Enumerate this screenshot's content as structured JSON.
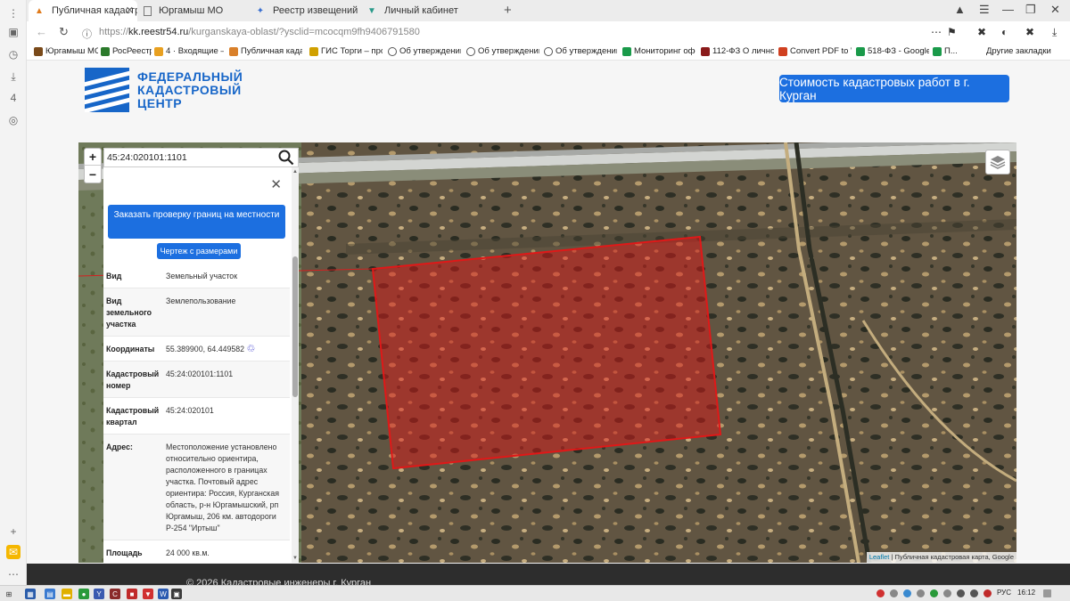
{
  "browser": {
    "tabs": [
      {
        "label": "Публичная кадастр",
        "icon": "site-favicon",
        "active": true
      },
      {
        "label": "Юргамыш МО",
        "icon": "page-icon"
      },
      {
        "label": "Реестр извещений",
        "icon": "emblem-icon"
      },
      {
        "label": "Личный кабинет",
        "icon": "cabinet-icon"
      }
    ],
    "url_prefix": "https://",
    "url_domain": "kk.reestr54.ru",
    "url_path": "/kurganskaya-oblast/?ysclid=mcocqm9fh9406791580",
    "bookmarks": [
      {
        "label": "Юргамыш МО",
        "color": "#7a4a1a"
      },
      {
        "label": "РосРеестр",
        "color": "#2b7a2b"
      },
      {
        "label": "4 · Входящие — Я",
        "color": "#e8a020"
      },
      {
        "label": "Публичная кадас",
        "color": "#d9802a"
      },
      {
        "label": "ГИС Торги – прод",
        "color": "#d0a000"
      },
      {
        "label": "Об утверждении",
        "color": "#555555"
      },
      {
        "label": "Об утверждении",
        "color": "#555555"
      },
      {
        "label": "Об утверждении",
        "color": "#555555"
      },
      {
        "label": "Мониторинг офо",
        "color": "#1a9a4a"
      },
      {
        "label": "112-ФЗ О личном",
        "color": "#8a1a1a"
      },
      {
        "label": "Convert PDF to W",
        "color": "#d04020"
      },
      {
        "label": "518-ФЗ - Google Т",
        "color": "#1a9a4a"
      },
      {
        "label": "П...",
        "color": "#1a9a4a"
      }
    ],
    "other_bookmarks": "Другие закладки"
  },
  "site": {
    "logo_line1": "ФЕДЕРАЛЬНЫЙ",
    "logo_line2": "КАДАСТРОВЫЙ",
    "logo_line3": "ЦЕНТР",
    "cta_label": "Стоимость кадастровых работ в г. Курган",
    "footer_text": "© 2026 Кадастровые инженеры г. Курган"
  },
  "map": {
    "zoom_in": "+",
    "zoom_out": "−",
    "search_value": "45:24:020101:1101",
    "attribution_link": "Leaflet",
    "attribution_text": " | Публичная кадастровая карта, Google",
    "parcel_color": "#e01818"
  },
  "panel": {
    "order_button": "Заказать проверку границ на местности",
    "drawing_button": "Чертеж с размерами",
    "rows": [
      {
        "key": "Вид",
        "value": "Земельный участок"
      },
      {
        "key": "Вид земельного участка",
        "value": "Землепользование"
      },
      {
        "key": "Координаты",
        "value": "55.389900, 64.449582"
      },
      {
        "key": "Кадастровый номер",
        "value": "45:24:020101:1101"
      },
      {
        "key": "Кадастровый квартал",
        "value": "45:24:020101"
      },
      {
        "key": "Адрес:",
        "value": "Местоположение установлено относительно ориентира, расположенного в границах участка. Почтовый адрес ориентира: Россия, Курганская область, р-н Юргамышский, рп Юргамыш, 206 км. автодороги Р-254 \"Иртыш\""
      },
      {
        "key": "Площадь уточненная:",
        "value": "24 000 кв.м."
      }
    ]
  },
  "taskbar": {
    "lang": "РУС",
    "time": "16:12"
  }
}
